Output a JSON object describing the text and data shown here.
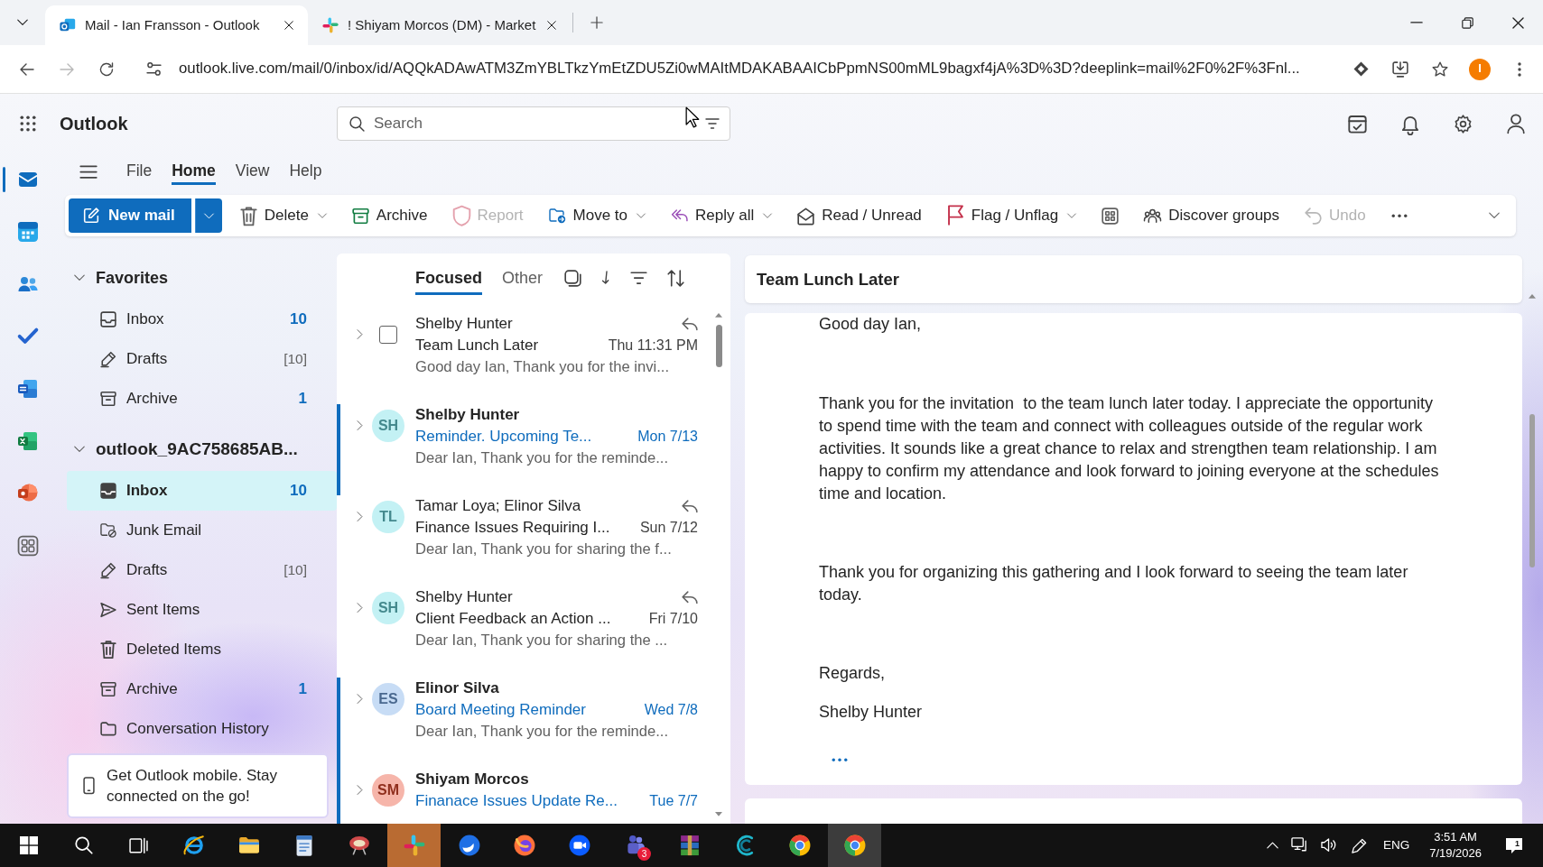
{
  "browser": {
    "tabs": [
      {
        "kind": "mail",
        "title": "Mail - Ian Fransson - Outlook",
        "selected": true
      },
      {
        "kind": "chat",
        "title": "! Shiyam Morcos (DM) - Market",
        "selected": false
      }
    ],
    "url": "outlook.live.com/mail/0/inbox/id/AQQkADAwATM3ZmYBLTkzYmEtZDU5Zi0wMAItMDAKABAAICbPpmNS00mML9bagxf4jA%3D%3D?deeplink=mail%2F0%2F%3Fnl...",
    "forward_disabled": true,
    "profile_initial": "I"
  },
  "header": {
    "app_name": "Outlook",
    "search": {
      "placeholder": "Search"
    }
  },
  "rail": [
    {
      "kind": "mail",
      "selected": true
    },
    {
      "kind": "calendar",
      "selected": false
    },
    {
      "kind": "people",
      "selected": false
    },
    {
      "kind": "todo",
      "selected": false
    },
    {
      "kind": "document",
      "selected": false
    },
    {
      "kind": "spreadsheet",
      "selected": false
    },
    {
      "kind": "presentation",
      "selected": false
    },
    {
      "kind": "apps",
      "selected": false
    }
  ],
  "ribbon": {
    "tabs": [
      {
        "label": "File",
        "selected": false
      },
      {
        "label": "Home",
        "selected": true
      },
      {
        "label": "View",
        "selected": false
      },
      {
        "label": "Help",
        "selected": false
      }
    ],
    "actions": [
      {
        "kind": "new-mail",
        "label": "New mail",
        "dropdown": true,
        "disabled": false
      },
      {
        "kind": "delete",
        "label": "Delete",
        "dropdown": true,
        "disabled": false
      },
      {
        "kind": "archive",
        "label": "Archive",
        "dropdown": false,
        "disabled": false
      },
      {
        "kind": "report",
        "label": "Report",
        "dropdown": false,
        "disabled": true
      },
      {
        "kind": "move",
        "label": "Move to",
        "dropdown": true,
        "disabled": false
      },
      {
        "kind": "reply-all",
        "label": "Reply all",
        "dropdown": true,
        "disabled": false
      },
      {
        "kind": "read",
        "label": "Read / Unread",
        "dropdown": false,
        "disabled": false
      },
      {
        "kind": "flag",
        "label": "Flag / Unflag",
        "dropdown": true,
        "disabled": false
      },
      {
        "kind": "layout",
        "dropdown": false,
        "disabled": false
      },
      {
        "kind": "groups",
        "label": "Discover groups",
        "dropdown": false,
        "disabled": false
      },
      {
        "kind": "undo",
        "label": "Undo",
        "dropdown": false,
        "disabled": true
      },
      {
        "kind": "more",
        "dropdown": false,
        "disabled": false
      }
    ]
  },
  "folders": {
    "sections": [
      {
        "label": "Favorites",
        "expanded": true,
        "items": [
          {
            "kind": "inbox",
            "label": "Inbox",
            "count": "10",
            "count_unread": true,
            "selected": false
          },
          {
            "kind": "drafts",
            "label": "Drafts",
            "count": "[10]",
            "count_unread": false,
            "selected": false
          },
          {
            "kind": "archive",
            "label": "Archive",
            "count": "1",
            "count_unread": true,
            "selected": false
          }
        ]
      },
      {
        "label": "outlook_9AC758685AB...",
        "expanded": true,
        "items": [
          {
            "kind": "inbox",
            "label": "Inbox",
            "count": "10",
            "count_unread": true,
            "selected": true
          },
          {
            "kind": "junk",
            "label": "Junk Email",
            "selected": false
          },
          {
            "kind": "drafts",
            "label": "Drafts",
            "count": "[10]",
            "count_unread": false,
            "selected": false
          },
          {
            "kind": "sent",
            "label": "Sent Items",
            "selected": false
          },
          {
            "kind": "deleted",
            "label": "Deleted Items",
            "selected": false
          },
          {
            "kind": "archive",
            "label": "Archive",
            "count": "1",
            "count_unread": true,
            "selected": false
          },
          {
            "kind": "folder",
            "label": "Conversation History",
            "selected": false
          }
        ]
      }
    ],
    "promo": {
      "text": "Get Outlook mobile. Stay connected on the go!"
    }
  },
  "message_list": {
    "tabs": [
      {
        "label": "Focused",
        "selected": true
      },
      {
        "label": "Other",
        "selected": false
      }
    ],
    "items": [
      {
        "kind": "checkbox",
        "checked": false,
        "sender": "Shelby Hunter",
        "subject": "Team Lunch Later",
        "date": "Thu 11:31 PM",
        "preview": "Good day Ian, Thank you for the invi...",
        "unread": false,
        "replied": true
      },
      {
        "kind": "avatar",
        "initials": "SH",
        "color": "#c3f1f4",
        "sender": "Shelby Hunter",
        "subject": "Reminder. Upcoming Te...",
        "date": "Mon 7/13",
        "preview": "Dear Ian, Thank you for the reminde...",
        "unread": true,
        "replied": false
      },
      {
        "kind": "avatar",
        "initials": "TL",
        "color": "#c3f1f4",
        "sender": "Tamar Loya; Elinor Silva",
        "subject": "Finance Issues Requiring I...",
        "date": "Sun 7/12",
        "preview": "Dear Ian, Thank you for sharing the f...",
        "unread": false,
        "replied": true
      },
      {
        "kind": "avatar",
        "initials": "SH",
        "color": "#c3f1f4",
        "sender": "Shelby Hunter",
        "subject": "Client Feedback an Action ...",
        "date": "Fri 7/10",
        "preview": "Dear Ian, Thank you for sharing the ...",
        "unread": false,
        "replied": true
      },
      {
        "kind": "avatar",
        "initials": "ES",
        "color": "#c7dcf5",
        "sender": "Elinor Silva",
        "subject": "Board Meeting Reminder",
        "date": "Wed 7/8",
        "preview": "Dear Ian, Thank you for the reminde...",
        "unread": true,
        "replied": false
      },
      {
        "kind": "avatar",
        "initials": "SM",
        "color": "#f6b5aa",
        "sender": "Shiyam Morcos",
        "subject": "Finanace Issues Update Re...",
        "date": "Tue 7/7",
        "unread": true,
        "replied": false
      }
    ]
  },
  "reading_pane": {
    "subject": "Team Lunch Later",
    "greeting": "Good day Ian,",
    "paragraphs": [
      "Thank you for the invitation  to the team lunch later today. I appreciate the opportunity to spend time with the team and connect with colleagues outside of the regular work activities. It sounds like a great chance to relax and strengthen team relationship. I am happy to confirm my attendance and look forward to joining everyone at the schedules time and location.",
      "Thank you for organizing this gathering and I look forward to seeing the team later today."
    ],
    "closing": "Regards,",
    "signature": "Shelby Hunter"
  },
  "taskbar": {
    "apps": [
      {
        "kind": "start",
        "selected": false,
        "flashing": false
      },
      {
        "kind": "search",
        "selected": false,
        "flashing": false
      },
      {
        "kind": "task-view",
        "selected": false,
        "flashing": false
      },
      {
        "kind": "e-browser",
        "selected": false,
        "flashing": false
      },
      {
        "kind": "file-explorer",
        "selected": false,
        "flashing": false
      },
      {
        "kind": "notepad",
        "selected": false,
        "flashing": false
      },
      {
        "kind": "disc-app",
        "selected": false,
        "flashing": false
      },
      {
        "kind": "pinwheel-app",
        "selected": false,
        "flashing": true
      },
      {
        "kind": "bird-mail",
        "selected": false,
        "flashing": false
      },
      {
        "kind": "fox-browser",
        "selected": false,
        "flashing": false
      },
      {
        "kind": "video-app",
        "selected": false,
        "flashing": false
      },
      {
        "kind": "team-chat",
        "selected": false,
        "flashing": false,
        "badge": "3"
      },
      {
        "kind": "archiver",
        "selected": false,
        "flashing": false
      },
      {
        "kind": "crescent-app",
        "selected": false,
        "flashing": false
      },
      {
        "kind": "circle-browser",
        "selected": false,
        "flashing": false
      },
      {
        "kind": "circle-browser",
        "selected": true,
        "flashing": false
      }
    ],
    "tray": {
      "language": "ENG",
      "time": "3:51 AM",
      "date": "7/19/2026",
      "notification_count": "1"
    }
  }
}
